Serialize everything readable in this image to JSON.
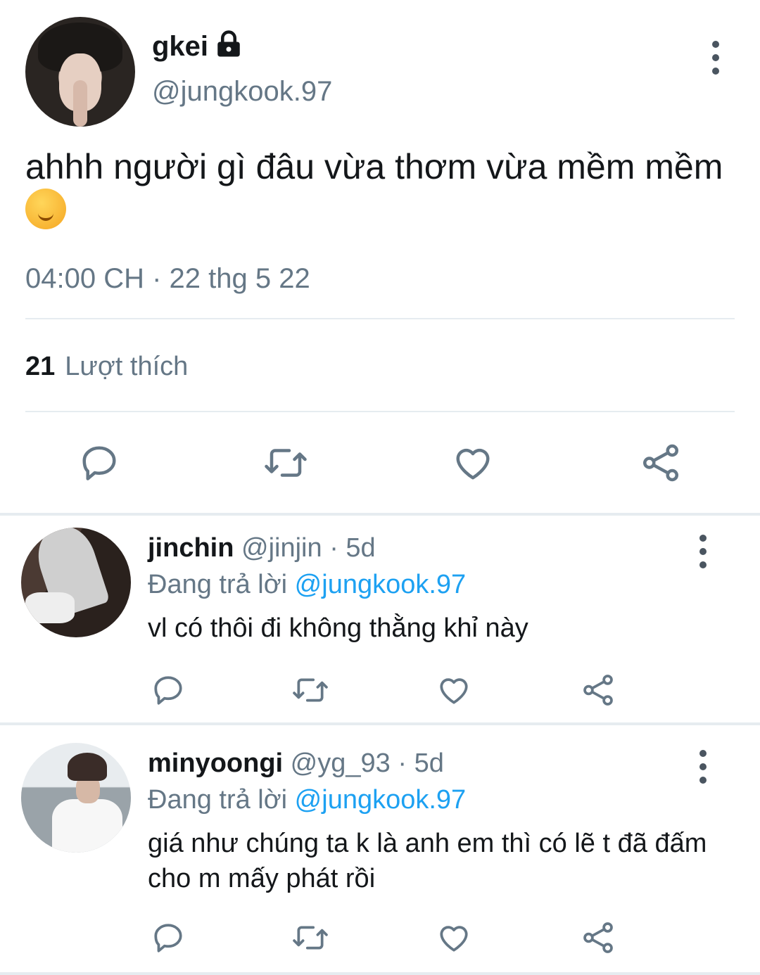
{
  "tweet": {
    "display_name": "gkei",
    "handle": "@jungkook.97",
    "text": "ahhh người gì đâu vừa thơm vừa mềm mềm",
    "emoji": "drooling-face-emoji",
    "timestamp": "04:00 CH · 22 thg 5 22",
    "likes_count": "21",
    "likes_label": "Lượt thích"
  },
  "replies": [
    {
      "display_name": "jinchin",
      "handle": "@jinjin",
      "age": "· 5d",
      "replying_prefix": "Đang trả lời",
      "replying_to": "@jungkook.97",
      "text": "vl có thôi đi không thằng khỉ này"
    },
    {
      "display_name": "minyoongi",
      "handle": "@yg_93",
      "age": "· 5d",
      "replying_prefix": "Đang trả lời",
      "replying_to": "@jungkook.97",
      "text": "giá như chúng ta k là anh em thì có lẽ t đã đấm cho m mấy phát rồi"
    }
  ],
  "icons": {
    "reply": "reply-icon",
    "retweet": "retweet-icon",
    "like": "heart-icon",
    "share": "share-icon",
    "more": "more-vertical-icon",
    "lock": "lock-icon"
  },
  "colors": {
    "icon": "#657786",
    "link": "#1da1f2",
    "divider": "#e6ecf0",
    "text": "#14171a",
    "secondary": "#657786"
  }
}
